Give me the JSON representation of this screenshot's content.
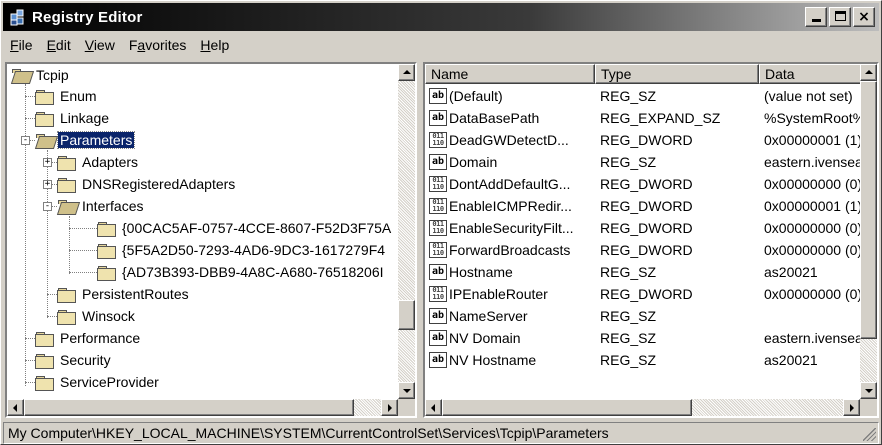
{
  "window": {
    "title": "Registry Editor",
    "controls": {
      "minimize": "_",
      "maximize": "□",
      "close": "×"
    }
  },
  "menu": [
    {
      "label": "File",
      "accel": "F",
      "rest": "ile"
    },
    {
      "label": "Edit",
      "accel": "E",
      "rest": "dit"
    },
    {
      "label": "View",
      "accel": "V",
      "rest": "iew"
    },
    {
      "label": "Favorites",
      "accel_prefix": "F",
      "accel": "a",
      "rest": "vorites"
    },
    {
      "label": "Help",
      "accel": "H",
      "rest": "elp"
    }
  ],
  "tree": {
    "nodes": [
      {
        "label": "Tcpip",
        "expanded": true
      },
      {
        "label": "Enum"
      },
      {
        "label": "Linkage"
      },
      {
        "label": "Parameters",
        "selected": true,
        "expanded": true
      },
      {
        "label": "Adapters",
        "expander": "+"
      },
      {
        "label": "DNSRegisteredAdapters",
        "expander": "+"
      },
      {
        "label": "Interfaces",
        "expander": "-"
      },
      {
        "label": "{00CAC5AF-0757-4CCE-8607-F52D3F75A"
      },
      {
        "label": "{5F5A2D50-7293-4AD6-9DC3-1617279F4"
      },
      {
        "label": "{AD73B393-DBB9-4A8C-A680-76518206I"
      },
      {
        "label": "PersistentRoutes"
      },
      {
        "label": "Winsock"
      },
      {
        "label": "Performance"
      },
      {
        "label": "Security"
      },
      {
        "label": "ServiceProvider"
      }
    ]
  },
  "list": {
    "columns": {
      "name": "Name",
      "type": "Type",
      "data": "Data"
    },
    "rows": [
      {
        "icon": "string-value-icon",
        "name": "(Default)",
        "type": "REG_SZ",
        "data": "(value not set)"
      },
      {
        "icon": "string-value-icon",
        "name": "DataBasePath",
        "type": "REG_EXPAND_SZ",
        "data": "%SystemRoot%\\"
      },
      {
        "icon": "binary-value-icon",
        "name": "DeadGWDetectD...",
        "type": "REG_DWORD",
        "data": "0x00000001 (1)"
      },
      {
        "icon": "string-value-icon",
        "name": "Domain",
        "type": "REG_SZ",
        "data": "eastern.ivensea"
      },
      {
        "icon": "binary-value-icon",
        "name": "DontAddDefaultG...",
        "type": "REG_DWORD",
        "data": "0x00000000 (0)"
      },
      {
        "icon": "binary-value-icon",
        "name": "EnableICMPRedir...",
        "type": "REG_DWORD",
        "data": "0x00000001 (1)"
      },
      {
        "icon": "binary-value-icon",
        "name": "EnableSecurityFilt...",
        "type": "REG_DWORD",
        "data": "0x00000000 (0)"
      },
      {
        "icon": "binary-value-icon",
        "name": "ForwardBroadcasts",
        "type": "REG_DWORD",
        "data": "0x00000000 (0)"
      },
      {
        "icon": "string-value-icon",
        "name": "Hostname",
        "type": "REG_SZ",
        "data": "as20021"
      },
      {
        "icon": "binary-value-icon",
        "name": "IPEnableRouter",
        "type": "REG_DWORD",
        "data": "0x00000000 (0)"
      },
      {
        "icon": "string-value-icon",
        "name": "NameServer",
        "type": "REG_SZ",
        "data": ""
      },
      {
        "icon": "string-value-icon",
        "name": "NV Domain",
        "type": "REG_SZ",
        "data": "eastern.ivensea"
      },
      {
        "icon": "string-value-icon",
        "name": "NV Hostname",
        "type": "REG_SZ",
        "data": "as20021"
      }
    ]
  },
  "icons": {
    "string": "ab",
    "binary_top": "011",
    "binary_bottom": "110"
  },
  "status": {
    "path": "My Computer\\HKEY_LOCAL_MACHINE\\SYSTEM\\CurrentControlSet\\Services\\Tcpip\\Parameters"
  },
  "colors": {
    "selection": "#0a246a",
    "face": "#d4d0c8",
    "title_start": "#000000",
    "title_end": "#bdbdbd"
  }
}
